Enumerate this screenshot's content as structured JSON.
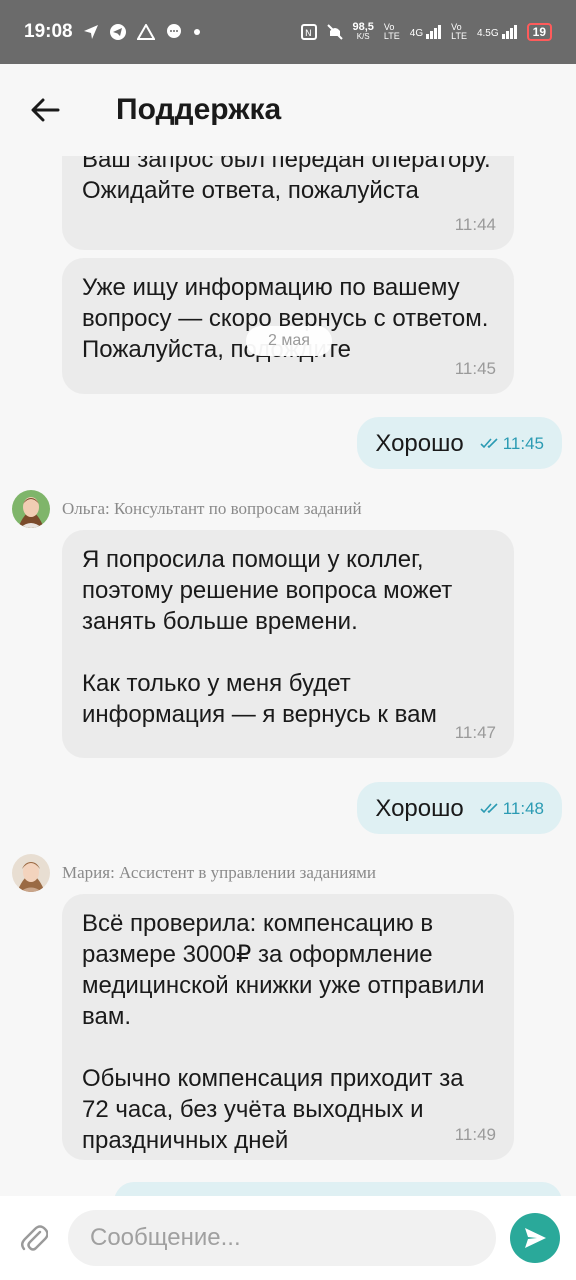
{
  "status_bar": {
    "time": "19:08",
    "icons": [
      "navigation-arrow-icon",
      "telegram-icon",
      "alert-icon",
      "chat-bubble-icon",
      "dot-icon"
    ],
    "right_icons": [
      "nfc-icon",
      "mute-icon",
      "speed-icon",
      "volte-icon",
      "signal-4g-icon",
      "volte-icon",
      "signal-4.5g-icon"
    ],
    "speed": "98,5",
    "speed_unit": "K/S",
    "net1": "4G",
    "net2": "4.5G",
    "battery": "19"
  },
  "header": {
    "title": "Поддержка",
    "back_icon": "back-arrow-icon"
  },
  "date_label": "2 мая",
  "messages": [
    {
      "text": "Ваш запрос был передан оператору. Ожидайте ответа, пожалуйста",
      "time": "11:44"
    },
    {
      "text": "Уже ищу информацию по вашему вопросу — скоро вернусь с ответом. Пожалуйста, подождите",
      "time": "11:45"
    },
    {
      "text": "Хорошо",
      "time": "11:45",
      "status_icon": "double-check-icon"
    },
    {
      "sender": "Ольга: Консультант по вопросам заданий",
      "avatar_icon": "avatar-olga"
    },
    {
      "text": "Я попросила помощи у коллег, поэтому решение вопроса может занять больше времени.\n\nКак только у меня будет информация — я вернусь к вам",
      "time": "11:47"
    },
    {
      "text": "Хорошо",
      "time": "11:48",
      "status_icon": "double-check-icon"
    },
    {
      "sender": "Мария: Ассистент в управлении заданиями",
      "avatar_icon": "avatar-maria"
    },
    {
      "text": "Всё проверила: компенсацию в размере 3000₽ за оформление медицинской книжки уже отправили вам.\n\nОбычно компенсация приходит за 72 часа, без учёта выходных и праздничных дней",
      "time": "11:49"
    }
  ],
  "composer": {
    "placeholder": "Сообщение...",
    "attach_icon": "paperclip-icon",
    "send_icon": "send-icon"
  },
  "colors": {
    "accent": "#2aa99a",
    "outgoing_bubble": "#dff0f3",
    "incoming_bubble": "#ebebeb",
    "read_tick": "#2b9bb3",
    "status_bar": "#6b6b6b"
  }
}
